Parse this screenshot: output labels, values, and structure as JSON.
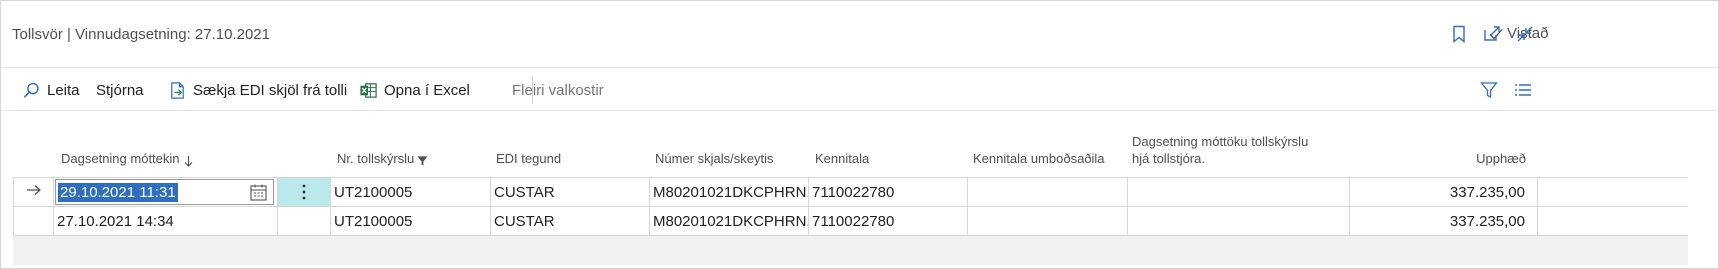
{
  "header": {
    "title": "Tollsvör | Vinnudagsetning: 27.10.2021",
    "saved_label": "Vistað",
    "icons": [
      "check-icon",
      "bookmark-icon",
      "open-in-new-window-icon",
      "collapse-icon"
    ]
  },
  "actions": {
    "search_label": "Leita",
    "manage_label": "Stjórna",
    "fetch_edi_label": "Sækja EDI skjöl frá tolli",
    "open_excel_label": "Opna í Excel",
    "more_options_label": "Fleiri valkostir",
    "icons": [
      "search-icon",
      "import-document-icon",
      "excel-icon",
      "filter-icon",
      "list-view-icon"
    ]
  },
  "grid": {
    "columns": [
      {
        "key": "received_date",
        "label": "Dagsetning móttekin",
        "sort": "descending"
      },
      {
        "key": "declaration_no",
        "label": "Nr. tollskýrslu",
        "filtered": true
      },
      {
        "key": "edi_type",
        "label": "EDI tegund"
      },
      {
        "key": "document_no",
        "label": "Númer skjals/skeytis"
      },
      {
        "key": "id_no",
        "label": "Kennitala"
      },
      {
        "key": "agent_id_no",
        "label": "Kennitala umboðsaðila"
      },
      {
        "key": "customs_received_date",
        "label": "Dagsetning móttöku tollskýrslu hjá tollstjóra."
      },
      {
        "key": "amount",
        "label": "Upphæð"
      }
    ],
    "rows": [
      {
        "selected": true,
        "received_date": "29.10.2021 11:31",
        "declaration_no": "UT2100005",
        "edi_type": "CUSTAR",
        "document_no": "M80201021DKCPHRN...",
        "id_no": "7110022780",
        "agent_id_no": "",
        "customs_received_date": "",
        "amount": "337.235,00"
      },
      {
        "selected": false,
        "received_date": "27.10.2021 14:34",
        "declaration_no": "UT2100005",
        "edi_type": "CUSTAR",
        "document_no": "M80201021DKCPHRN...",
        "id_no": "7110022780",
        "agent_id_no": "",
        "customs_received_date": "",
        "amount": "337.235,00"
      }
    ]
  },
  "colors": {
    "accent": "#2f6fbf",
    "selection": "#2f6fbf",
    "active_cell": "#b9e9ea",
    "border": "#d6d6d6",
    "muted_text": "#505050"
  }
}
